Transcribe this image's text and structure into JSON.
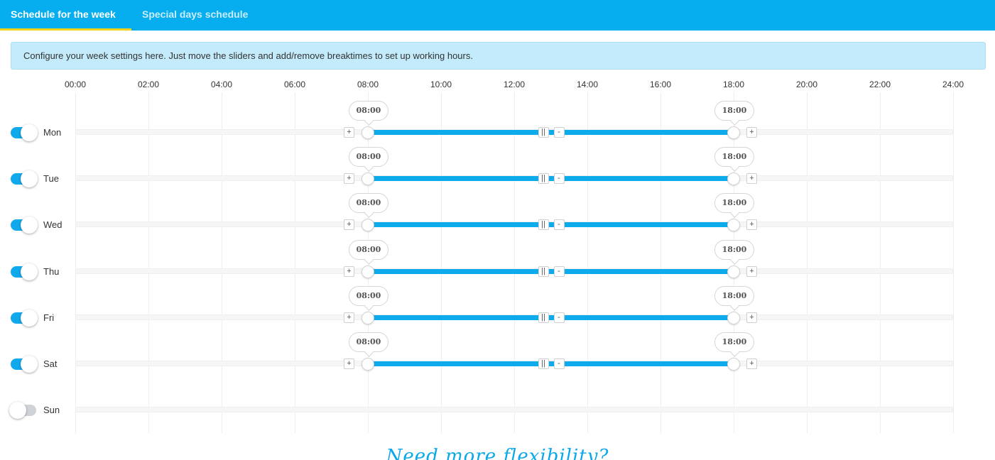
{
  "tabs": [
    {
      "label": "Schedule for the week",
      "active": true
    },
    {
      "label": "Special days schedule",
      "active": false
    }
  ],
  "info_text": "Configure your week settings here. Just move the sliders and add/remove breaktimes to set up working hours.",
  "timeline": {
    "ticks": [
      "00:00",
      "02:00",
      "04:00",
      "06:00",
      "08:00",
      "10:00",
      "12:00",
      "14:00",
      "16:00",
      "18:00",
      "20:00",
      "22:00",
      "24:00"
    ]
  },
  "days": [
    {
      "label": "Mon",
      "enabled": true,
      "start": "08:00",
      "end": "18:00"
    },
    {
      "label": "Tue",
      "enabled": true,
      "start": "08:00",
      "end": "18:00"
    },
    {
      "label": "Wed",
      "enabled": true,
      "start": "08:00",
      "end": "18:00"
    },
    {
      "label": "Thu",
      "enabled": true,
      "start": "08:00",
      "end": "18:00"
    },
    {
      "label": "Fri",
      "enabled": true,
      "start": "08:00",
      "end": "18:00"
    },
    {
      "label": "Sat",
      "enabled": true,
      "start": "08:00",
      "end": "18:00"
    },
    {
      "label": "Sun",
      "enabled": false,
      "start": "",
      "end": ""
    }
  ],
  "controls": {
    "add_label": "+",
    "remove_label": "-",
    "pause_label": "||"
  },
  "footer_text": "Need more flexibility?",
  "colors": {
    "tabbar": "#06aef0",
    "active_tab_underline": "#f2d21b",
    "info_bg": "#c3ebfb",
    "range": "#0eabec",
    "toggle_on": "#12a9ec",
    "toggle_off": "#cfd2d6"
  }
}
